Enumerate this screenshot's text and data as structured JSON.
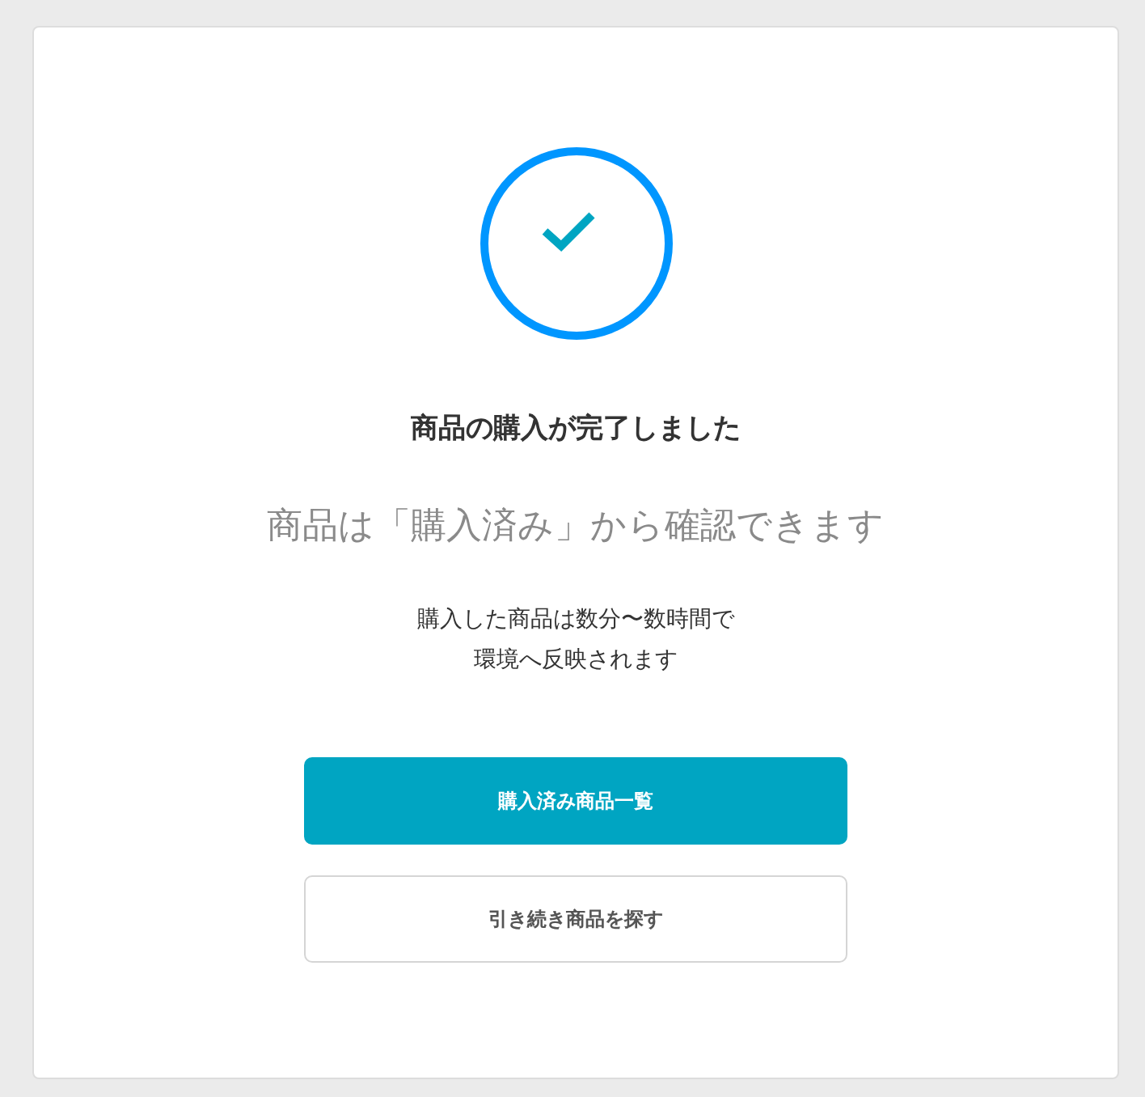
{
  "title": "商品の購入が完了しました",
  "subtitle": "商品は「購入済み」から確認できます",
  "message": [
    "購入した商品は数分〜数時間で",
    "環境へ反映されます"
  ],
  "buttons": [
    {
      "label": "購入済み商品一覧",
      "kind": "primary"
    },
    {
      "label": "引き続き商品を探す",
      "kind": "secondary"
    }
  ]
}
